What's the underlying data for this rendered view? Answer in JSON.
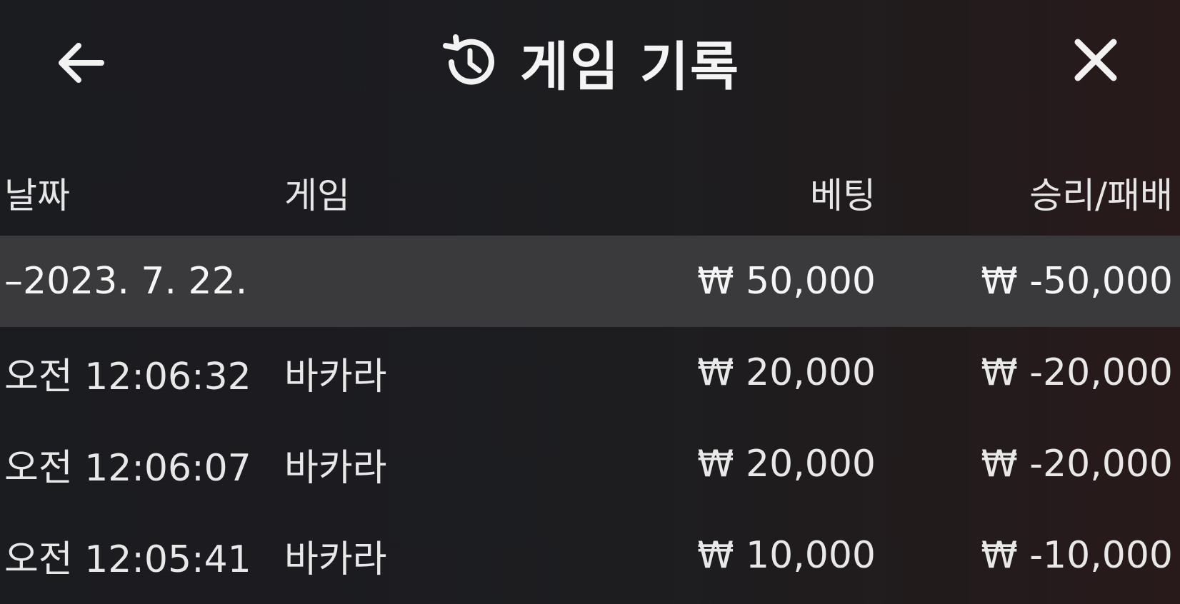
{
  "header": {
    "title": "게임 기록",
    "back_icon": "arrow-left-icon",
    "title_icon": "history-icon",
    "close_icon": "close-icon"
  },
  "table": {
    "columns": {
      "date": "날짜",
      "game": "게임",
      "bet": "베팅",
      "result": "승리/패배"
    },
    "group": {
      "date": "–2023. 7. 22.",
      "bet": "₩ 50,000",
      "result": "₩ -50,000"
    },
    "rows": [
      {
        "time": "오전 12:06:32",
        "game": "바카라",
        "bet": "₩ 20,000",
        "result": "₩ -20,000"
      },
      {
        "time": "오전 12:06:07",
        "game": "바카라",
        "bet": "₩ 20,000",
        "result": "₩ -20,000"
      },
      {
        "time": "오전 12:05:41",
        "game": "바카라",
        "bet": "₩ 10,000",
        "result": "₩ -10,000"
      }
    ]
  },
  "colors": {
    "background": "#1c1c20",
    "group_row": "#3a3a3c",
    "text": "#ededed"
  }
}
